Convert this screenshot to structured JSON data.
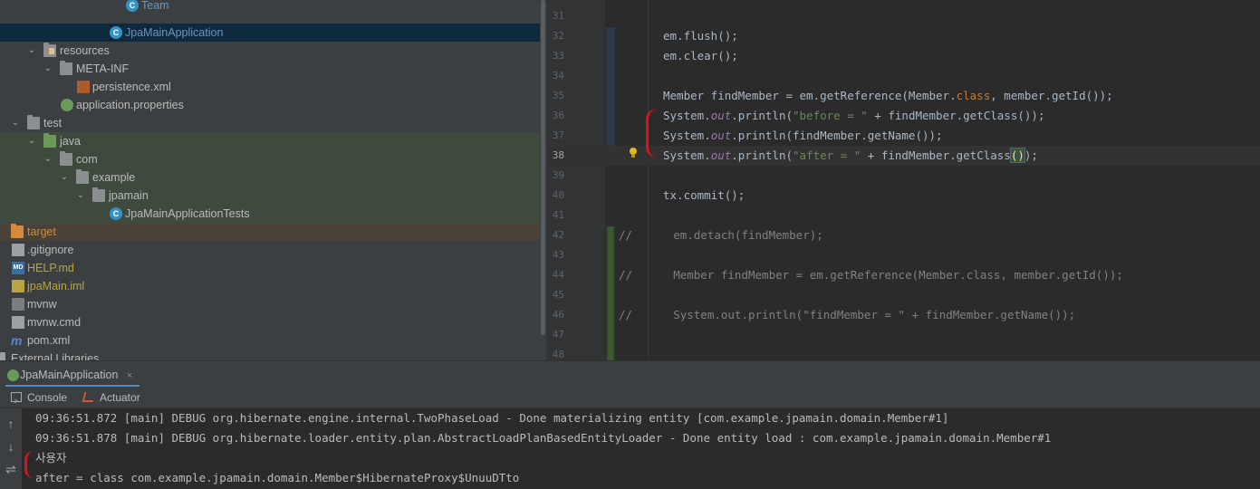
{
  "project_tree": {
    "items": [
      {
        "label": "Team",
        "icon": "class-icon",
        "color": "#6897bb"
      },
      {
        "label": "JpaMainApplication",
        "icon": "spring-boot-class-icon",
        "color": "#6897bb"
      },
      {
        "label": "resources",
        "icon": "resources-folder-icon",
        "color": "#bbbbbb"
      },
      {
        "label": "META-INF",
        "icon": "folder-icon",
        "color": "#bbbbbb"
      },
      {
        "label": "persistence.xml",
        "icon": "xml-file-icon",
        "color": "#bbbbbb"
      },
      {
        "label": "application.properties",
        "icon": "spring-properties-icon",
        "color": "#bbbbbb"
      },
      {
        "label": "test",
        "icon": "folder-icon",
        "color": "#bbbbbb"
      },
      {
        "label": "java",
        "icon": "test-source-folder-icon",
        "color": "#bbbbbb"
      },
      {
        "label": "com",
        "icon": "package-icon",
        "color": "#bbbbbb"
      },
      {
        "label": "example",
        "icon": "package-icon",
        "color": "#bbbbbb"
      },
      {
        "label": "jpamain",
        "icon": "package-icon",
        "color": "#bbbbbb"
      },
      {
        "label": "JpaMainApplicationTests",
        "icon": "spring-boot-class-icon",
        "color": "#bbbbbb"
      },
      {
        "label": "target",
        "icon": "excluded-folder-icon",
        "color": "#d48a3a"
      },
      {
        "label": ".gitignore",
        "icon": "file-icon",
        "color": "#bbbbbb"
      },
      {
        "label": "HELP.md",
        "icon": "markdown-file-icon",
        "color": "#b8a442"
      },
      {
        "label": "jpaMain.iml",
        "icon": "iml-file-icon",
        "color": "#b8a442"
      },
      {
        "label": "mvnw",
        "icon": "shell-file-icon",
        "color": "#bbbbbb"
      },
      {
        "label": "mvnw.cmd",
        "icon": "file-icon",
        "color": "#bbbbbb"
      },
      {
        "label": "pom.xml",
        "icon": "maven-icon",
        "color": "#bbbbbb"
      },
      {
        "label": "External Libraries",
        "icon": "library-icon",
        "color": "#bbbbbb"
      }
    ]
  },
  "editor": {
    "line_numbers": [
      "31",
      "32",
      "33",
      "34",
      "35",
      "36",
      "37",
      "38",
      "39",
      "40",
      "41",
      "42",
      "43",
      "44",
      "45",
      "46",
      "47",
      "48"
    ],
    "current_line": "38",
    "lines": {
      "l32": "em.flush();",
      "l33": "em.clear();",
      "l35_a": "Member findMember = em.getReference(Member.",
      "l35_b": "class",
      "l35_c": ", member.getId());",
      "l36_a": "System.",
      "l36_b": "out",
      "l36_c": ".println(",
      "l36_d": "\"before = \"",
      "l36_e": " + findMember.getClass());",
      "l37_a": "System.",
      "l37_b": "out",
      "l37_c": ".println(findMember.getName());",
      "l38_a": "System.",
      "l38_b": "out",
      "l38_c": ".println(",
      "l38_d": "\"after = \"",
      "l38_e": " + findMember.getClass",
      "l38_f": "()",
      "l38_g": ");",
      "l40": "tx.commit();",
      "l42": "//      em.detach(findMember);",
      "l44": "//      Member findMember = em.getReference(Member.class, member.getId());",
      "l46": "//      System.out.println(\"findMember = \" + findMember.getName());"
    }
  },
  "run_panel": {
    "tab_label": "JpaMainApplication",
    "close_glyph": "×",
    "tool_tabs": {
      "console": "Console",
      "actuator": "Actuator"
    },
    "side_tools": {
      "up": "↑",
      "down": "↓",
      "wrap": "⇌"
    },
    "output": [
      "09:36:51.872 [main] DEBUG org.hibernate.engine.internal.TwoPhaseLoad - Done materializing entity [com.example.jpamain.domain.Member#1]",
      "09:36:51.878 [main] DEBUG org.hibernate.loader.entity.plan.AbstractLoadPlanBasedEntityLoader - Done entity load : com.example.jpamain.domain.Member#1",
      "사용자",
      "after = class com.example.jpamain.domain.Member$HibernateProxy$UnuuDTto"
    ]
  },
  "colors": {
    "background": "#2b2b2b",
    "tree_background": "#3c3f41",
    "keyword": "#cc7832",
    "string": "#6a8759",
    "static_field": "#9876aa",
    "annotation_marker": "#e0131a"
  }
}
